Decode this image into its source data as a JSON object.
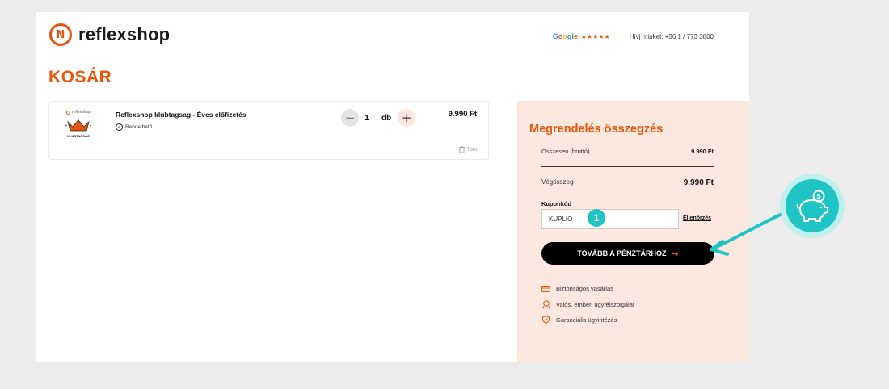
{
  "header": {
    "brand_name": "reflexshop",
    "brand_logo_letter": "N",
    "google_parts": [
      "G",
      "o",
      "o",
      "g",
      "l",
      "e"
    ],
    "rating_stars": "★★★★★",
    "phone_text": "Hívj minket: +36 1 / 773 3800"
  },
  "page_title": "KOSÁR",
  "cart_item": {
    "image_brand": "reflexshop",
    "image_label": "KLUBTAGSÁG",
    "name": "Reflexshop klubtagsag - Éves előfizetés",
    "availability": "Rendelhető",
    "quantity": "1",
    "unit": "db",
    "price": "9.990 Ft",
    "delete_label": "Töröl"
  },
  "summary": {
    "title": "Megrendelés összegzés",
    "gross_label": "Összesen (bruttó)",
    "gross_value": "9.990 Ft",
    "total_label": "Végösszeg",
    "total_value": "9.990 Ft",
    "coupon_label": "Kuponkód",
    "coupon_value": "KUPLIO",
    "check_label": "Ellenőrzés",
    "checkout_label": "TOVÁBB A PÉNZTÁRHOZ",
    "benefits": [
      "Biztonságos vásárlás",
      "Valós, emberi ügyfélszolgálat",
      "Garanciális ügyintézés"
    ]
  },
  "annotation": {
    "step_number": "1"
  },
  "colors": {
    "accent": "#e8560e",
    "summary_bg": "#fde8df",
    "annotation": "#20c4c4"
  }
}
